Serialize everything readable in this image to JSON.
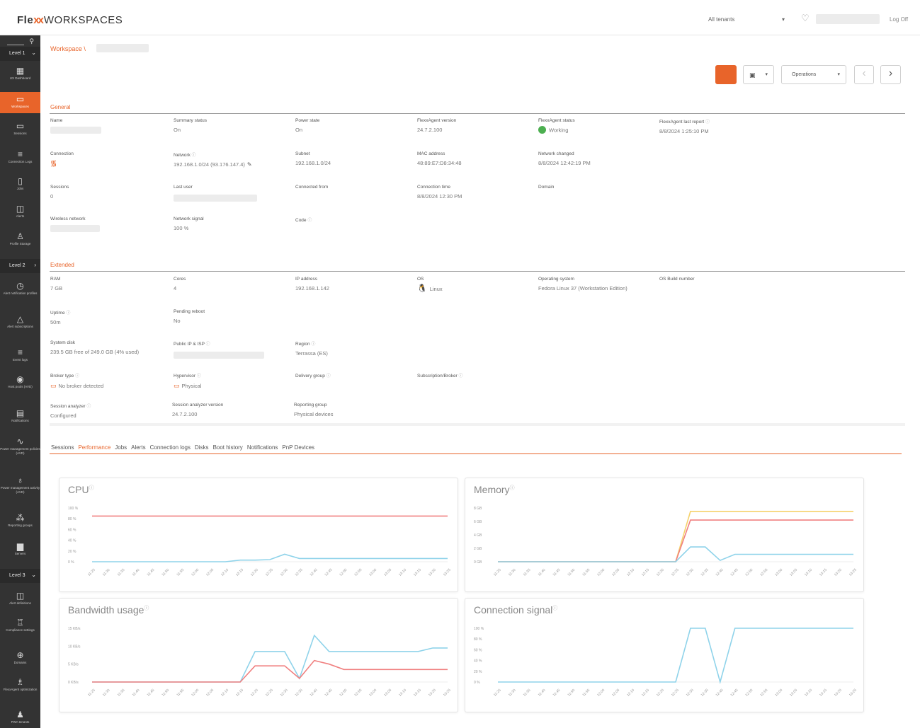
{
  "header": {
    "logo_bold": "Fle",
    "logo_x": "xx",
    "logo_rest": "WORKSPACES",
    "tenant": "All tenants",
    "logoff": "Log Off"
  },
  "sidebar": {
    "levels": [
      "Level 1",
      "Level 2",
      "Level 3"
    ],
    "items": [
      {
        "label": "UX Dashboard",
        "icon": "dashboard-icon"
      },
      {
        "label": "Workspaces",
        "icon": "monitor-icon"
      },
      {
        "label": "Sessions",
        "icon": "sessions-icon"
      },
      {
        "label": "Connection Logs",
        "icon": "list-icon"
      },
      {
        "label": "Jobs",
        "icon": "document-icon"
      },
      {
        "label": "Alerts",
        "icon": "alert-box-icon"
      },
      {
        "label": "Profile Storage",
        "icon": "profile-icon"
      },
      {
        "label": "Alert notification profiles",
        "icon": "clock-icon"
      },
      {
        "label": "Alert subscriptions",
        "icon": "warning-icon"
      },
      {
        "label": "Event logs",
        "icon": "list-icon"
      },
      {
        "label": "Host pools (AVD)",
        "icon": "circle-icon"
      },
      {
        "label": "Notifications",
        "icon": "message-icon"
      },
      {
        "label": "Power management policies (AVD)",
        "icon": "pulse-icon"
      },
      {
        "label": "Power management activity (AVD)",
        "icon": "plug-icon"
      },
      {
        "label": "Reporting groups",
        "icon": "group-icon"
      },
      {
        "label": "Servers",
        "icon": "server-icon"
      },
      {
        "label": "Alert definitions",
        "icon": "alert-box-icon"
      },
      {
        "label": "Compliance settings",
        "icon": "compliance-icon"
      },
      {
        "label": "Domains",
        "icon": "globe-icon"
      },
      {
        "label": "FlexxAgent optimization",
        "icon": "optimize-icon"
      },
      {
        "label": "PWA tenants",
        "icon": "users-icon"
      }
    ]
  },
  "breadcrumb": "Workspace \\",
  "toolbar": {
    "operations": "Operations"
  },
  "general": {
    "title": "General",
    "fields": {
      "name_label": "Name",
      "summary_status_label": "Summary status",
      "summary_status": "On",
      "power_state_label": "Power state",
      "power_state": "On",
      "agent_version_label": "FlexxAgent version",
      "agent_version": "24.7.2.100",
      "agent_status_label": "FlexxAgent status",
      "agent_status": "Working",
      "agent_last_report_label": "FlexxAgent last report",
      "agent_last_report": "8/8/2024 1:25:10 PM",
      "connection_label": "Connection",
      "network_label": "Network",
      "network": "192.168.1.0/24 (93.176.147.4)",
      "subnet_label": "Subnet",
      "subnet": "192.168.1.0/24",
      "mac_label": "MAC address",
      "mac": "48:89:E7:D8:34:48",
      "network_changed_label": "Network changed",
      "network_changed": "8/8/2024 12:42:19 PM",
      "sessions_label": "Sessions",
      "sessions": "0",
      "last_user_label": "Last user",
      "connected_from_label": "Connected from",
      "connection_time_label": "Connection time",
      "connection_time": "8/8/2024 12:30 PM",
      "domain_label": "Domain",
      "wireless_label": "Wireless network",
      "signal_label": "Network signal",
      "signal": "100 %",
      "code_label": "Code"
    }
  },
  "extended": {
    "title": "Extended",
    "fields": {
      "ram_label": "RAM",
      "ram": "7 GB",
      "cores_label": "Cores",
      "cores": "4",
      "ip_label": "IP address",
      "ip": "192.168.1.142",
      "os_label": "OS",
      "os": "Linux",
      "operating_system_label": "Operating system",
      "operating_system": "Fedora Linux 37 (Workstation Edition)",
      "os_build_label": "OS Build number",
      "uptime_label": "Uptime",
      "uptime": "50m",
      "pending_reboot_label": "Pending reboot",
      "pending_reboot": "No",
      "system_disk_label": "System disk",
      "system_disk": "239.5 GB free of 249.0 GB (4% used)",
      "public_ip_label": "Public IP & ISP",
      "region_label": "Region",
      "region": "Terrassa (ES)",
      "broker_type_label": "Broker type",
      "broker_type": "No broker detected",
      "hypervisor_label": "Hypervisor",
      "hypervisor": "Physical",
      "delivery_group_label": "Delivery group",
      "subscription_label": "Subscription/Broker",
      "session_analyzer_label": "Session analyzer",
      "session_analyzer": "Configured",
      "session_analyzer_version_label": "Session analyzer version",
      "session_analyzer_version": "24.7.2.100",
      "reporting_group_label": "Reporting group",
      "reporting_group": "Physical devices"
    }
  },
  "tabs": [
    "Sessions",
    "Performance",
    "Jobs",
    "Alerts",
    "Connection logs",
    "Disks",
    "Boot history",
    "Notifications",
    "PnP Devices"
  ],
  "active_tab": "Performance",
  "times": [
    "11:25",
    "11:30",
    "11:35",
    "11:40",
    "11:45",
    "11:50",
    "11:55",
    "12:00",
    "12:05",
    "12:10",
    "12:15",
    "12:20",
    "12:25",
    "12:30",
    "12:35",
    "12:40",
    "12:45",
    "12:50",
    "12:55",
    "13:00",
    "13:05",
    "13:10",
    "13:15",
    "13:20",
    "13:25"
  ],
  "chart_data": [
    {
      "type": "line",
      "title": "CPU",
      "y_ticks": [
        "100 %",
        "80 %",
        "60 %",
        "40 %",
        "20 %",
        "0 %"
      ],
      "ylim": [
        0,
        100
      ],
      "series": [
        {
          "color": "#f08080",
          "values": [
            85,
            85,
            85,
            85,
            85,
            85,
            85,
            85,
            85,
            85,
            85,
            85,
            85,
            85,
            85,
            85,
            85,
            85,
            85,
            85,
            85,
            85,
            85,
            85,
            85
          ]
        },
        {
          "color": "#8fd3ea",
          "values": [
            0,
            0,
            0,
            0,
            0,
            0,
            0,
            0,
            0,
            0,
            3,
            3,
            4,
            14,
            6,
            6,
            6,
            6,
            6,
            6,
            6,
            6,
            6,
            6,
            6
          ]
        }
      ]
    },
    {
      "type": "line",
      "title": "Memory",
      "y_ticks": [
        "8 GB",
        "6 GB",
        "4 GB",
        "2 GB",
        "0 GB"
      ],
      "ylim": [
        0,
        8
      ],
      "series": [
        {
          "color": "#f5d26b",
          "values": [
            0,
            0,
            0,
            0,
            0,
            0,
            0,
            0,
            0,
            0,
            0,
            0,
            0,
            7.5,
            7.5,
            7.5,
            7.5,
            7.5,
            7.5,
            7.5,
            7.5,
            7.5,
            7.5,
            7.5,
            7.5
          ]
        },
        {
          "color": "#f08080",
          "values": [
            0,
            0,
            0,
            0,
            0,
            0,
            0,
            0,
            0,
            0,
            0,
            0,
            0,
            6.2,
            6.2,
            6.2,
            6.2,
            6.2,
            6.2,
            6.2,
            6.2,
            6.2,
            6.2,
            6.2,
            6.2
          ]
        },
        {
          "color": "#8fd3ea",
          "values": [
            0,
            0,
            0,
            0,
            0,
            0,
            0,
            0,
            0,
            0,
            0,
            0,
            0,
            2.2,
            2.2,
            0.2,
            1.1,
            1.1,
            1.1,
            1.1,
            1.1,
            1.1,
            1.1,
            1.1,
            1.1
          ]
        }
      ]
    },
    {
      "type": "line",
      "title": "Bandwidth usage",
      "y_ticks": [
        "15 KB/s",
        "10 KB/s",
        "5 KB/s",
        "0 KB/s"
      ],
      "ylim": [
        0,
        15
      ],
      "series": [
        {
          "color": "#8fd3ea",
          "values": [
            0,
            0,
            0,
            0,
            0,
            0,
            0,
            0,
            0,
            0,
            0,
            8.5,
            8.5,
            8.5,
            1,
            13,
            8.5,
            8.5,
            8.5,
            8.5,
            8.5,
            8.5,
            8.5,
            9.5,
            9.5
          ]
        },
        {
          "color": "#f08080",
          "values": [
            0,
            0,
            0,
            0,
            0,
            0,
            0,
            0,
            0,
            0,
            0,
            4.5,
            4.5,
            4.5,
            1,
            6,
            5,
            3.5,
            3.5,
            3.5,
            3.5,
            3.5,
            3.5,
            3.5,
            3.5
          ]
        }
      ]
    },
    {
      "type": "line",
      "title": "Connection signal",
      "y_ticks": [
        "100 %",
        "80 %",
        "60 %",
        "40 %",
        "20 %",
        "0 %"
      ],
      "ylim": [
        0,
        100
      ],
      "series": [
        {
          "color": "#8fd3ea",
          "values": [
            0,
            0,
            0,
            0,
            0,
            0,
            0,
            0,
            0,
            0,
            0,
            0,
            0,
            100,
            100,
            0,
            100,
            100,
            100,
            100,
            100,
            100,
            100,
            100,
            100
          ]
        }
      ]
    }
  ]
}
